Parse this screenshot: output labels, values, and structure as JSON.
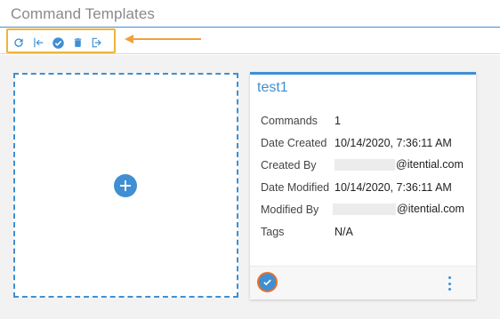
{
  "header": {
    "title": "Command Templates"
  },
  "toolbar": {
    "buttons": [
      {
        "name": "refresh",
        "icon": "refresh-icon"
      },
      {
        "name": "import",
        "icon": "import-icon"
      },
      {
        "name": "validate",
        "icon": "check-circle-icon"
      },
      {
        "name": "delete",
        "icon": "trash-icon"
      },
      {
        "name": "export",
        "icon": "export-icon"
      }
    ],
    "highlight_color": "#f0b33c"
  },
  "annotation": {
    "arrow_color": "#f0a03c"
  },
  "add_tile": {
    "icon": "plus-icon"
  },
  "card": {
    "title": "test1",
    "fields": [
      {
        "label": "Commands",
        "value": "1"
      },
      {
        "label": "Date Created",
        "value": "10/14/2020, 7:36:11 AM"
      },
      {
        "label": "Created By",
        "value": "@itential.com"
      },
      {
        "label": "Date Modified",
        "value": "10/14/2020, 7:36:11 AM"
      },
      {
        "label": "Modified By",
        "value": "@itential.com"
      },
      {
        "label": "Tags",
        "value": "N/A"
      }
    ]
  },
  "colors": {
    "accent": "#3f8fd2",
    "focus_ring": "#e8712c",
    "background": "#f2f2f2"
  }
}
